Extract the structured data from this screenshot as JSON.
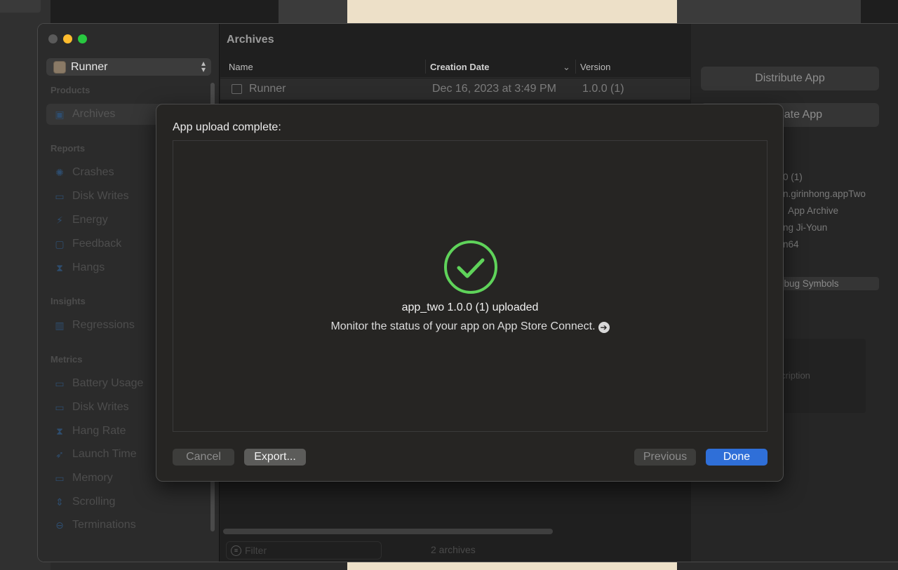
{
  "window": {
    "scheme": {
      "label": "Runner",
      "icon": "app-icon"
    },
    "sidebar": {
      "sections": [
        {
          "title": "Products",
          "items": [
            {
              "label": "Archives",
              "icon": "archive-icon"
            }
          ]
        },
        {
          "title": "Reports",
          "items": [
            {
              "label": "Crashes",
              "icon": "crash-icon"
            },
            {
              "label": "Disk Writes",
              "icon": "disk-icon"
            },
            {
              "label": "Energy",
              "icon": "bolt-icon"
            },
            {
              "label": "Feedback",
              "icon": "feedback-icon"
            },
            {
              "label": "Hangs",
              "icon": "hourglass-icon"
            }
          ]
        },
        {
          "title": "Insights",
          "items": [
            {
              "label": "Regressions",
              "icon": "bar-chart-icon"
            }
          ]
        },
        {
          "title": "Metrics",
          "items": [
            {
              "label": "Battery Usage",
              "icon": "battery-icon"
            },
            {
              "label": "Disk Writes",
              "icon": "disk-icon"
            },
            {
              "label": "Hang Rate",
              "icon": "hourglass-icon"
            },
            {
              "label": "Launch Time",
              "icon": "rocket-icon"
            },
            {
              "label": "Memory",
              "icon": "memory-icon"
            },
            {
              "label": "Scrolling",
              "icon": "scroll-icon"
            },
            {
              "label": "Terminations",
              "icon": "terminate-icon"
            }
          ]
        }
      ]
    },
    "archives": {
      "title": "Archives",
      "columns": {
        "name": "Name",
        "date": "Creation Date",
        "version": "Version"
      },
      "rows": [
        {
          "name": "Runner",
          "date": "Dec 16, 2023 at 3:49 PM",
          "version": "1.0.0 (1)"
        }
      ],
      "filter_placeholder": "Filter",
      "count": "2 archives"
    },
    "inspector": {
      "distribute": "Distribute App",
      "validate": "ate App",
      "info": [
        "0 (1)",
        "n.girinhong.appTwo",
        "App Archive",
        "ng Ji-Youn",
        "n64"
      ],
      "debug_symbols": "ebug Symbols",
      "description": "cription"
    }
  },
  "sheet": {
    "title": "App upload complete:",
    "status": "app_two 1.0.0 (1) uploaded",
    "monitor": "Monitor the status of your app on App Store Connect.",
    "success_color": "#5fd35a",
    "buttons": {
      "cancel": "Cancel",
      "export": "Export...",
      "previous": "Previous",
      "done": "Done"
    }
  }
}
